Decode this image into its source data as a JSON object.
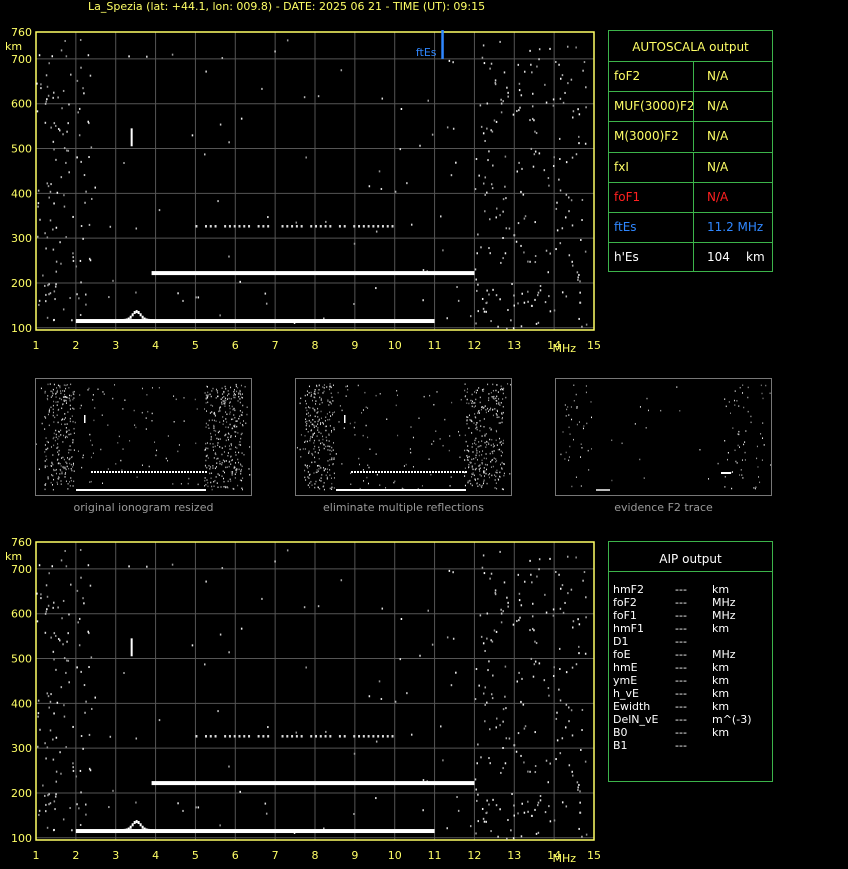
{
  "title": "La_Spezia (lat: +44.1, lon: 009.8) - DATE: 2025 06 21 - TIME (UT): 09:15",
  "colors": {
    "axis": "#ffff66",
    "grid": "#555555",
    "panel_border": "#3cb34a",
    "fte": "#2f87ff",
    "fof1": "#ff2020",
    "trace": "#ffffff"
  },
  "chart_data": [
    {
      "type": "scatter",
      "name": "main-ionogram",
      "x_unit_label": "MHz",
      "y_unit_label": "km",
      "xlim": [
        1,
        15
      ],
      "ylim": [
        95,
        760
      ],
      "x_ticks": [
        1,
        2,
        3,
        4,
        5,
        6,
        7,
        8,
        9,
        10,
        11,
        12,
        13,
        14,
        15
      ],
      "y_ticks": [
        100,
        200,
        300,
        400,
        500,
        600,
        700,
        760
      ],
      "grid": true,
      "annotation": {
        "label": "ftEs",
        "x": 11.2
      },
      "traces": [
        {
          "x_start": 2.0,
          "x_end": 11.0,
          "y": 115,
          "kind": "E-layer echo"
        },
        {
          "x_start": 3.9,
          "x_end": 12.0,
          "y": 222,
          "kind": "Es second hop"
        },
        {
          "x_start": 5.0,
          "x_end": 10.0,
          "y": 327,
          "kind": "third hop"
        },
        {
          "x_start": 3.4,
          "x_end": 3.4,
          "y_from": 505,
          "y_to": 545,
          "kind": "spike"
        }
      ]
    },
    {
      "type": "scatter",
      "name": "aip-ionogram",
      "x_unit_label": "MHz",
      "y_unit_label": "km",
      "xlim": [
        1,
        15
      ],
      "ylim": [
        95,
        760
      ],
      "x_ticks": [
        1,
        2,
        3,
        4,
        5,
        6,
        7,
        8,
        9,
        10,
        11,
        12,
        13,
        14,
        15
      ],
      "y_ticks": [
        100,
        200,
        300,
        400,
        500,
        600,
        700,
        760
      ],
      "grid": true
    }
  ],
  "autoscala": {
    "header": "AUTOSCALA output",
    "rows": [
      {
        "label": "foF2",
        "value": "N/A",
        "unit": "",
        "color": "#ffff66"
      },
      {
        "label": "MUF(3000)F2",
        "value": "N/A",
        "unit": "",
        "color": "#ffff66"
      },
      {
        "label": "M(3000)F2",
        "value": "N/A",
        "unit": "",
        "color": "#ffff66"
      },
      {
        "label": "fxI",
        "value": "N/A",
        "unit": "",
        "color": "#ffff66"
      },
      {
        "label": "foF1",
        "value": "N/A",
        "unit": "",
        "color": "#ff2020"
      },
      {
        "label": "ftEs",
        "value": "11.2 MHz",
        "unit": "",
        "color": "#2f87ff"
      },
      {
        "label": "h'Es",
        "value": "104",
        "unit": "km",
        "color": "#ffffff"
      }
    ]
  },
  "aip": {
    "header": "AIP output",
    "rows": [
      {
        "label": "hmF2",
        "value": "---",
        "unit": "km"
      },
      {
        "label": "foF2",
        "value": "---",
        "unit": "MHz"
      },
      {
        "label": "foF1",
        "value": "---",
        "unit": "MHz"
      },
      {
        "label": "hmF1",
        "value": "---",
        "unit": "km"
      },
      {
        "label": "D1",
        "value": "---",
        "unit": ""
      },
      {
        "label": "foE",
        "value": "---",
        "unit": "MHz"
      },
      {
        "label": "hmE",
        "value": "---",
        "unit": "km"
      },
      {
        "label": "ymE",
        "value": "---",
        "unit": "km"
      },
      {
        "label": "h_vE",
        "value": "---",
        "unit": "km"
      },
      {
        "label": "Ewidth",
        "value": "---",
        "unit": "km"
      },
      {
        "label": "DelN_vE",
        "value": "---",
        "unit": "m^(-3)"
      },
      {
        "label": "B0",
        "value": "---",
        "unit": "km"
      },
      {
        "label": "B1",
        "value": "---",
        "unit": ""
      }
    ]
  },
  "thumbnails": [
    {
      "caption": "original ionogram resized"
    },
    {
      "caption": "eliminate multiple reflections"
    },
    {
      "caption": "evidence F2 trace"
    }
  ]
}
